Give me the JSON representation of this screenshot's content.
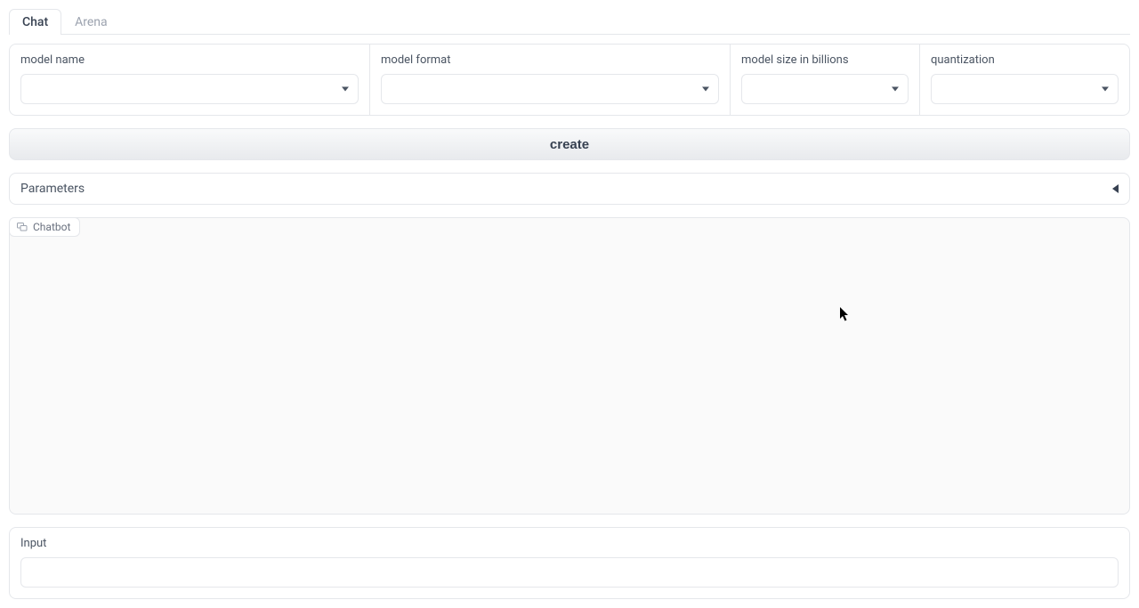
{
  "tabs": {
    "chat": "Chat",
    "arena": "Arena"
  },
  "config": {
    "model_name": {
      "label": "model name",
      "value": ""
    },
    "model_format": {
      "label": "model format",
      "value": ""
    },
    "model_size": {
      "label": "model size in billions",
      "value": ""
    },
    "quantization": {
      "label": "quantization",
      "value": ""
    }
  },
  "create_button": "create",
  "parameters": {
    "label": "Parameters"
  },
  "chatbot": {
    "label": "Chatbot"
  },
  "input": {
    "label": "Input",
    "value": ""
  }
}
